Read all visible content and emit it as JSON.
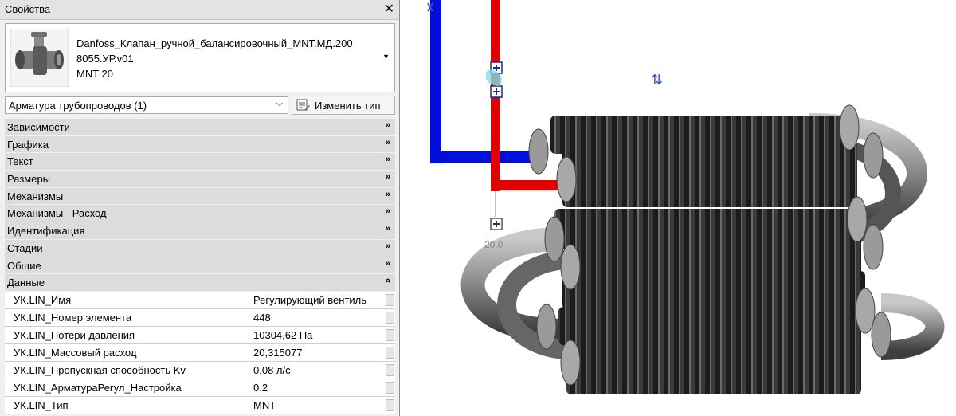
{
  "properties": {
    "title": "Свойства",
    "close_icon": "close-icon",
    "type_selector": {
      "name_line1": "Danfoss_Клапан_ручной_балансировочный_MNT.МД.200",
      "name_line2": "8055.УР.v01",
      "name_line3": "MNT 20"
    },
    "filter": {
      "label": "Арматура трубопроводов (1)"
    },
    "edit_type_label": "Изменить тип",
    "groups": [
      {
        "label": "Зависимости",
        "expanded": false
      },
      {
        "label": "Графика",
        "expanded": false
      },
      {
        "label": "Текст",
        "expanded": false
      },
      {
        "label": "Размеры",
        "expanded": false
      },
      {
        "label": "Механизмы",
        "expanded": false
      },
      {
        "label": "Механизмы - Расход",
        "expanded": false
      },
      {
        "label": "Идентификация",
        "expanded": false
      },
      {
        "label": "Стадии",
        "expanded": false
      },
      {
        "label": "Общие",
        "expanded": false
      },
      {
        "label": "Данные",
        "expanded": true
      }
    ],
    "rows": [
      {
        "name": "УК.LIN_Имя",
        "value": "Регулирующий вентиль"
      },
      {
        "name": "УК.LIN_Номер элемента",
        "value": "448"
      },
      {
        "name": "УК.LIN_Потери давления",
        "value": "10304,62 Па"
      },
      {
        "name": "УК.LIN_Массовый расход",
        "value": "20,315077"
      },
      {
        "name": "УК.LIN_Пропускная способность Kv",
        "value": "0,08 л/с"
      },
      {
        "name": "УК.LIN_АрматураРегул_Настройка",
        "value": "0.2"
      },
      {
        "name": "УК.LIN_Тип",
        "value": "MNT"
      }
    ]
  },
  "viewport": {
    "dimension_label": "20.0",
    "colors": {
      "supply_pipe": "#e00000",
      "return_pipe": "#0000e0",
      "radiator": "#2e2e2e"
    },
    "icons": [
      "flip-arrows-icon",
      "connector-plus-icon",
      "rotate-icon"
    ]
  }
}
